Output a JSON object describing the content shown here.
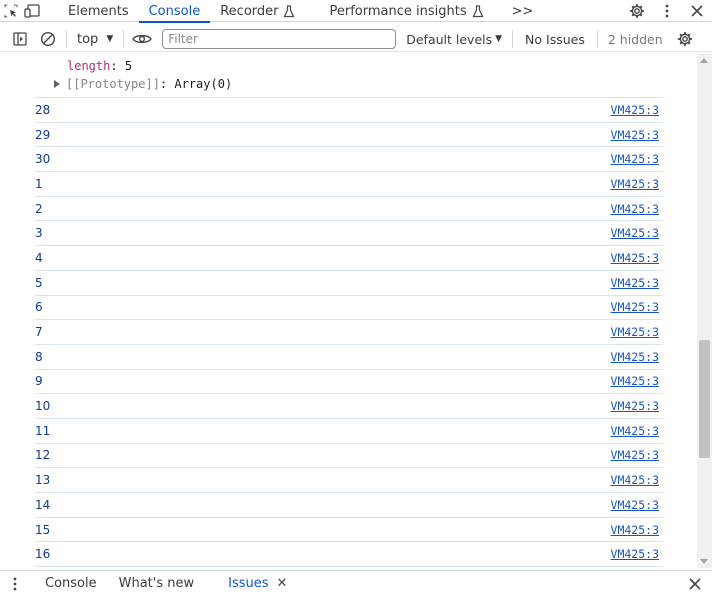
{
  "tabbar": {
    "tabs": [
      {
        "label": "Elements",
        "active": false
      },
      {
        "label": "Console",
        "active": true
      },
      {
        "label": "Recorder",
        "active": false
      },
      {
        "label": "Performance insights",
        "active": false
      }
    ],
    "more_label": ">>"
  },
  "toolbar": {
    "context": "top",
    "filter_placeholder": "Filter",
    "filter_value": "",
    "levels_label": "Default levels",
    "issues_label": "No Issues",
    "hidden_label": "2 hidden"
  },
  "console": {
    "object_length_key": "length",
    "object_length_value": "5",
    "prototype_label": "[[Prototype]]",
    "prototype_value": "Array(0)",
    "logs": [
      {
        "value": "28",
        "source": "VM425:3"
      },
      {
        "value": "29",
        "source": "VM425:3"
      },
      {
        "value": "30",
        "source": "VM425:3"
      },
      {
        "value": "1",
        "source": "VM425:3"
      },
      {
        "value": "2",
        "source": "VM425:3"
      },
      {
        "value": "3",
        "source": "VM425:3"
      },
      {
        "value": "4",
        "source": "VM425:3"
      },
      {
        "value": "5",
        "source": "VM425:3"
      },
      {
        "value": "6",
        "source": "VM425:3"
      },
      {
        "value": "7",
        "source": "VM425:3"
      },
      {
        "value": "8",
        "source": "VM425:3"
      },
      {
        "value": "9",
        "source": "VM425:3"
      },
      {
        "value": "10",
        "source": "VM425:3"
      },
      {
        "value": "11",
        "source": "VM425:3"
      },
      {
        "value": "12",
        "source": "VM425:3"
      },
      {
        "value": "13",
        "source": "VM425:3"
      },
      {
        "value": "14",
        "source": "VM425:3"
      },
      {
        "value": "15",
        "source": "VM425:3"
      },
      {
        "value": "16",
        "source": "VM425:3"
      }
    ]
  },
  "drawer": {
    "tabs": [
      {
        "label": "Console",
        "active": false
      },
      {
        "label": "What's new",
        "active": false
      },
      {
        "label": "Issues",
        "active": true
      }
    ]
  },
  "colors": {
    "accent": "#0b57d0",
    "log_value": "#0e3a8f",
    "link": "#1a55c4",
    "object_key": "#a8307f",
    "row_border": "#d7e3ef"
  },
  "icons": {
    "inspect": "inspect-element-icon",
    "device": "device-toolbar-icon",
    "sidebar": "sidebar-toggle-icon",
    "clear": "clear-console-icon",
    "eye": "live-expression-eye-icon",
    "settings": "gear-icon",
    "more": "vertical-dots-icon",
    "close": "close-icon"
  }
}
